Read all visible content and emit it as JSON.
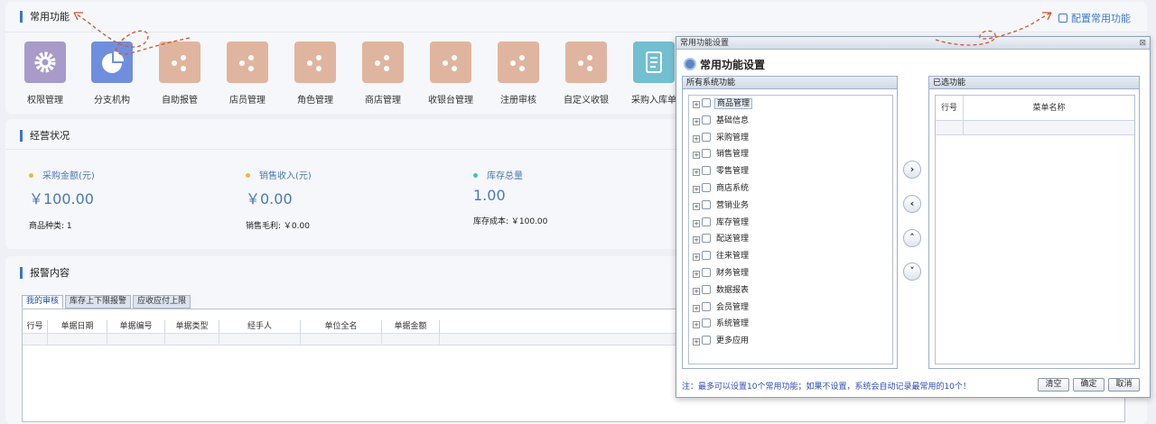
{
  "common": {
    "title": "常用功能",
    "config_link": "配置常用功能",
    "items": [
      {
        "label": "权限管理",
        "icon": "gear-icon",
        "color": "#a89bc9"
      },
      {
        "label": "分支机构",
        "icon": "pie-chart-icon",
        "color": "#6f8fde"
      },
      {
        "label": "自助报管",
        "icon": "dots-icon",
        "color": "#e0b59f"
      },
      {
        "label": "店员管理",
        "icon": "dots-icon",
        "color": "#e0b59f"
      },
      {
        "label": "角色管理",
        "icon": "dots-icon",
        "color": "#e0b59f"
      },
      {
        "label": "商店管理",
        "icon": "dots-icon",
        "color": "#e0b59f"
      },
      {
        "label": "收银台管理",
        "icon": "dots-icon",
        "color": "#e0b59f"
      },
      {
        "label": "注册审核",
        "icon": "dots-icon",
        "color": "#e0b59f"
      },
      {
        "label": "自定义收银",
        "icon": "dots-icon",
        "color": "#e0b59f"
      },
      {
        "label": "采购入库单",
        "icon": "scroll-icon",
        "color": "#72bfd0"
      }
    ]
  },
  "business": {
    "title": "经营状况",
    "stats": [
      {
        "label": "采购金额(元)",
        "value": "￥100.00",
        "sub": "商品种类: 1",
        "dot": "#f2b53a"
      },
      {
        "label": "销售收入(元)",
        "value": "￥0.00",
        "sub": "销售毛利: ￥0.00",
        "dot": "#f2b53a"
      },
      {
        "label": "库存总量",
        "value": "1.00",
        "sub": "库存成本: ￥100.00",
        "dot": "#45c1b4"
      }
    ]
  },
  "alerts": {
    "title": "报警内容",
    "tabs": [
      "我的审核",
      "库存上下限报警",
      "应收应付上限"
    ],
    "columns": [
      "行号",
      "单据日期",
      "单据编号",
      "单据类型",
      "经手人",
      "单位全名",
      "单据金额"
    ]
  },
  "dialog": {
    "window_title": "常用功能设置",
    "heading": "常用功能设置",
    "left_panel_title": "所有系统功能",
    "tree": [
      "商品管理",
      "基础信息",
      "采购管理",
      "销售管理",
      "零售管理",
      "商店系统",
      "营销业务",
      "库存管理",
      "配送管理",
      "往来管理",
      "财务管理",
      "数据报表",
      "会员管理",
      "系统管理",
      "更多应用"
    ],
    "right_panel_title": "已选功能",
    "right_columns": [
      "行号",
      "菜单名称"
    ],
    "note": "注：最多可以设置10个常用功能；如果不设置，系统会自动记录最常用的10个！",
    "buttons": [
      "清空",
      "确定",
      "取消"
    ],
    "arrow_buttons": [
      "›",
      "‹",
      "^",
      "v"
    ]
  }
}
